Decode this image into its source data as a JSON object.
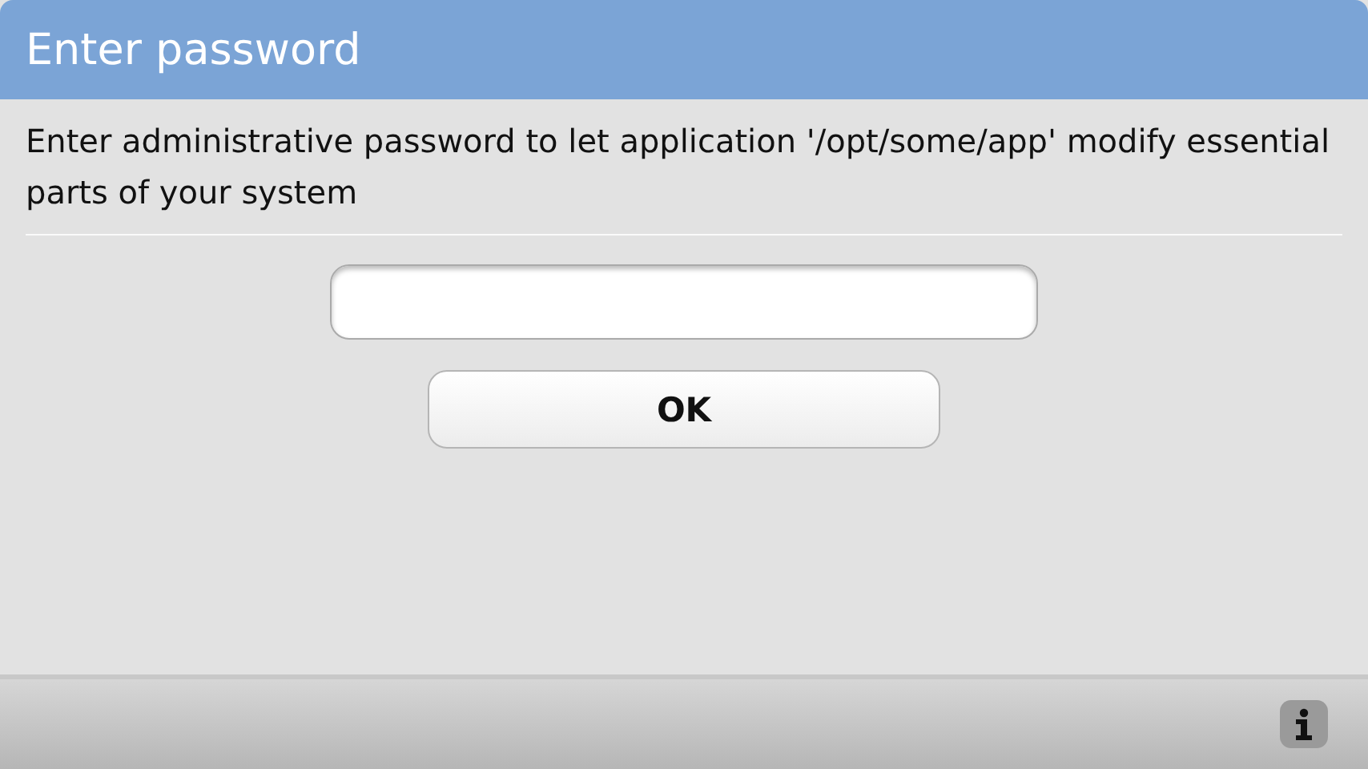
{
  "window": {
    "title": "Enter password"
  },
  "message": "Enter administrative password to let application '/opt/some/app' modify essential parts of your system",
  "buttons": [
    "OK"
  ]
}
